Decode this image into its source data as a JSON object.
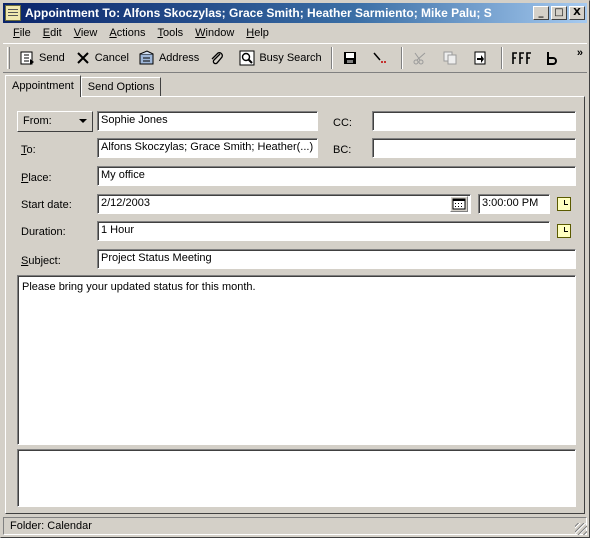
{
  "window": {
    "title": "Appointment To: Alfons Skoczylas; Grace Smith; Heather Sarmiento; Mike Palu; S",
    "minimize": "_",
    "maximize": "□",
    "close": "X"
  },
  "menu": [
    {
      "first": "F",
      "rest": "ile"
    },
    {
      "first": "E",
      "rest": "dit"
    },
    {
      "first": "V",
      "rest": "iew"
    },
    {
      "first": "A",
      "rest": "ctions"
    },
    {
      "first": "T",
      "rest": "ools"
    },
    {
      "first": "W",
      "rest": "indow"
    },
    {
      "first": "H",
      "rest": "elp"
    }
  ],
  "toolbar": {
    "send": "Send",
    "cancel": "Cancel",
    "address": "Address",
    "busy_search": "Busy Search",
    "more": "»"
  },
  "tabs": {
    "appointment": "Appointment",
    "send_options": "Send Options"
  },
  "form": {
    "from_button": "From:",
    "from_value": "Sophie Jones",
    "cc_label": "CC:",
    "cc_value": "",
    "to_label_first": "T",
    "to_label_rest": "o:",
    "to_value": "Alfons Skoczylas; Grace Smith; Heather(...)",
    "bc_label": "BC:",
    "bc_value": "",
    "place_label_first": "P",
    "place_label_rest": "lace:",
    "place_value": "My office",
    "start_date_label": "Start date:",
    "start_date_value": "2/12/2003",
    "start_time_value": "3:00:00 PM",
    "duration_label": "Duration:",
    "duration_value": "1 Hour",
    "subject_label_first": "S",
    "subject_label_rest": "ubject:",
    "subject_value": "Project Status Meeting",
    "message": "Please bring your updated status for this month."
  },
  "status": {
    "folder": "Folder: Calendar"
  }
}
